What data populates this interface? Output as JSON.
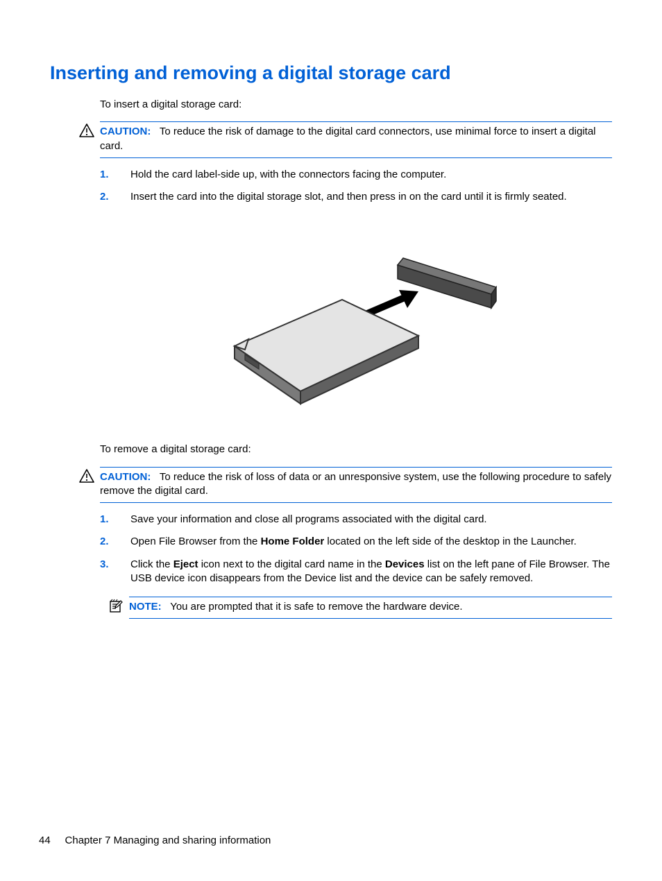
{
  "title": "Inserting and removing a digital storage card",
  "insert_intro": "To insert a digital storage card:",
  "caution1": {
    "label": "CAUTION:",
    "text": "To reduce the risk of damage to the digital card connectors, use minimal force to insert a digital card."
  },
  "insert_steps": {
    "s1": {
      "num": "1.",
      "text": "Hold the card label-side up, with the connectors facing the computer."
    },
    "s2": {
      "num": "2.",
      "text": "Insert the card into the digital storage slot, and then press in on the card until it is firmly seated."
    }
  },
  "remove_intro": "To remove a digital storage card:",
  "caution2": {
    "label": "CAUTION:",
    "text": "To reduce the risk of loss of data or an unresponsive system, use the following procedure to safely remove the digital card."
  },
  "remove_steps": {
    "s1": {
      "num": "1.",
      "text": "Save your information and close all programs associated with the digital card."
    },
    "s2": {
      "num": "2.",
      "pre": "Open File Browser from the ",
      "bold1": "Home Folder",
      "post": " located on the left side of the desktop in the Launcher."
    },
    "s3": {
      "num": "3.",
      "pre": "Click the ",
      "bold1": "Eject",
      "mid": " icon next to the digital card name in the ",
      "bold2": "Devices",
      "post": " list on the left pane of File Browser. The USB device icon disappears from the Device list and the device can be safely removed."
    }
  },
  "note": {
    "label": "NOTE:",
    "text": "You are prompted that it is safe to remove the hardware device."
  },
  "footer": {
    "page": "44",
    "chapter": "Chapter 7   Managing and sharing information"
  }
}
